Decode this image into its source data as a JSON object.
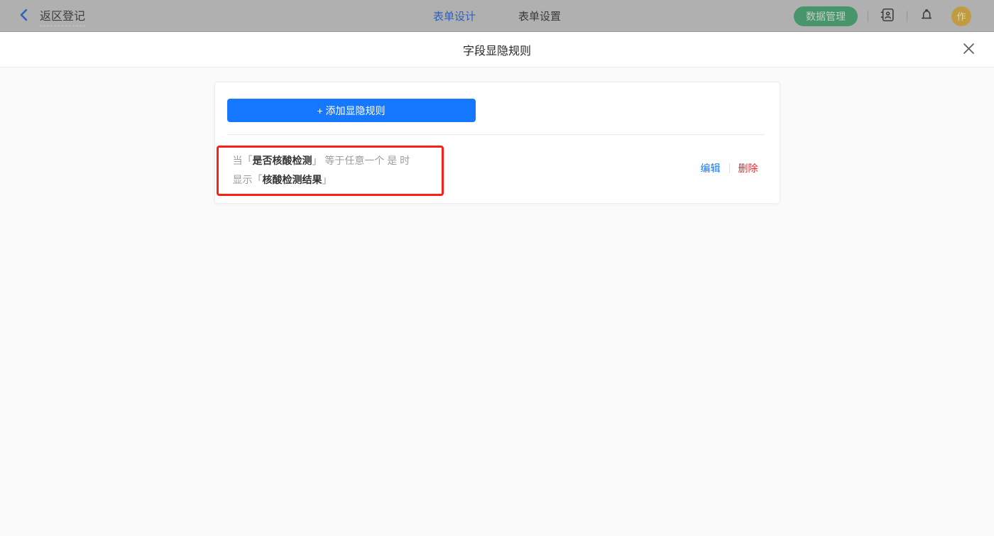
{
  "topbar": {
    "form_title": "返区登记",
    "tabs": [
      {
        "label": "表单设计",
        "active": true
      },
      {
        "label": "表单设置",
        "active": false
      }
    ],
    "data_manage_label": "数据管理",
    "avatar_text": "作",
    "icons": [
      "chevron-left-icon",
      "contacts-icon",
      "bell-icon"
    ]
  },
  "modal": {
    "title": "字段显隐规则",
    "close_icon": "close-icon",
    "add_rule_label": "+ 添加显隐规则",
    "rules": [
      {
        "when_prefix": "当「",
        "when_field": "是否核酸检测",
        "when_suffix": "」 等于任意一个 是 时",
        "show_prefix": "显示「",
        "show_field": "核酸检测结果",
        "show_suffix": "」",
        "edit_label": "编辑",
        "delete_label": "删除"
      }
    ]
  },
  "colors": {
    "accent_blue": "#1677ff",
    "highlight_red": "#fa2016",
    "delete_red": "#f5222d",
    "data_manage_green": "#46956b",
    "avatar_gold": "#c09c41",
    "topbar_dimmed_bg": "#b0b0b0",
    "modal_body_bg": "#fafafa"
  }
}
